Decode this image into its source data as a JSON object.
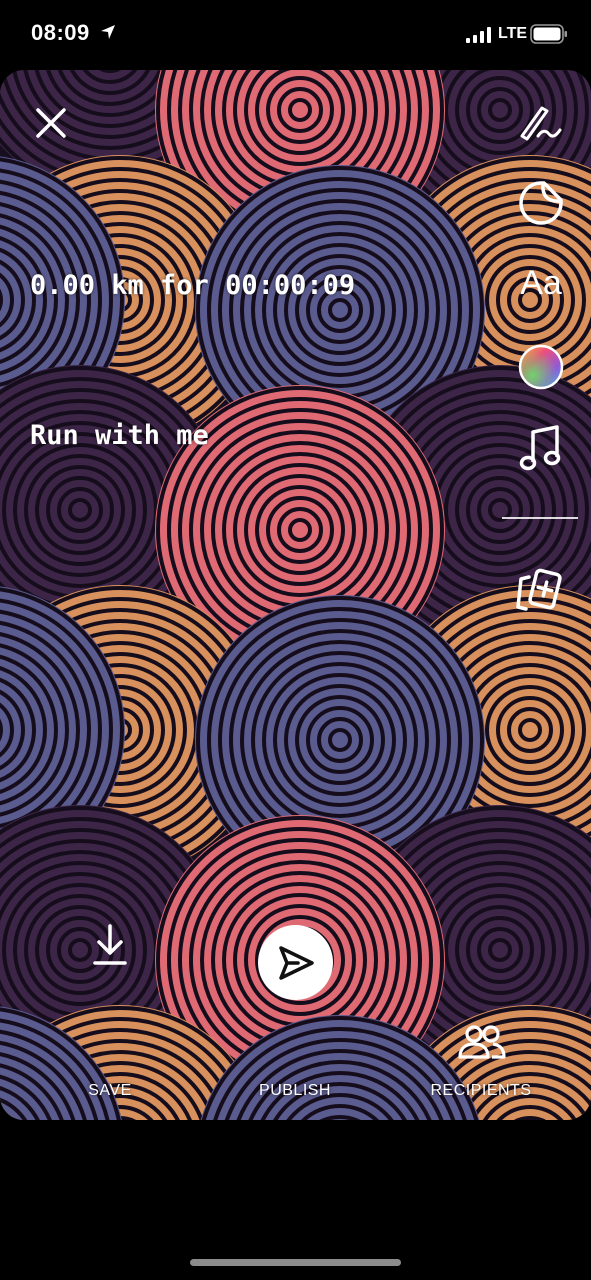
{
  "status_bar": {
    "time": "08:09",
    "network": "LTE",
    "icons": [
      "location-arrow-icon",
      "signal-bars-icon",
      "battery-icon"
    ]
  },
  "story": {
    "stats_text": "0.00 km for 00:00:09",
    "caption_text": "Run with me",
    "background_palette": [
      "#e06a74",
      "#d8905c",
      "#5a5b8e",
      "#3d2548"
    ]
  },
  "toolbar": {
    "close_icon": "close-icon",
    "draw_icon": "pen-draw-icon",
    "sticker_icon": "sticker-icon",
    "text_label": "Aa",
    "color_icon": "color-wheel-icon",
    "music_icon": "music-note-icon",
    "cards_icon": "add-card-icon"
  },
  "bottom_bar": {
    "save_label": "SAVE",
    "publish_label": "PUBLISH",
    "recipients_label": "RECIPIENTS",
    "save_icon": "download-icon",
    "publish_icon": "send-icon",
    "recipients_icon": "people-icon"
  }
}
